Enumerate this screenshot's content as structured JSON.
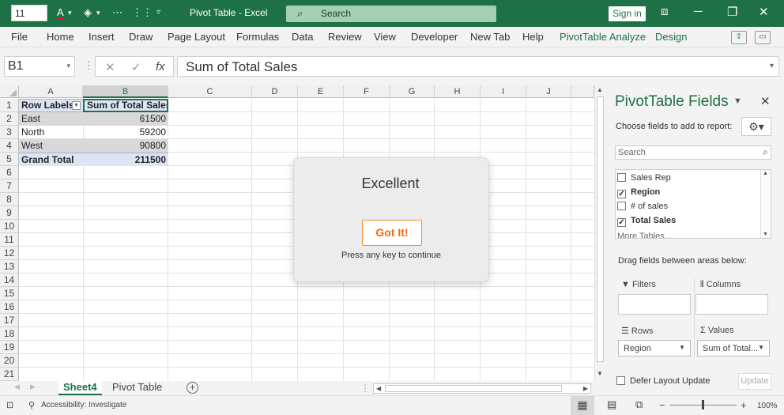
{
  "titlebar": {
    "font_size_value": "11",
    "doc_title": "Pivot Table  -  Excel",
    "search_placeholder": "Search",
    "signin": "Sign in",
    "accent": "#1e7145"
  },
  "menu": [
    "File",
    "Home",
    "Insert",
    "Draw",
    "Page Layout",
    "Formulas",
    "Data",
    "Review",
    "View",
    "Developer",
    "New Tab",
    "Help",
    "PivotTable Analyze",
    "Design"
  ],
  "formula_bar": {
    "name_box": "B1",
    "cancel_glyph": "✕",
    "enter_glyph": "✓",
    "fx": "fx",
    "content": "Sum of Total Sales"
  },
  "sheet": {
    "columns": [
      "A",
      "B",
      "C",
      "D",
      "E",
      "F",
      "G",
      "H",
      "I",
      "J"
    ],
    "rows": [
      "1",
      "2",
      "3",
      "4",
      "5",
      "6",
      "7",
      "8",
      "9",
      "10",
      "11",
      "12",
      "13",
      "14",
      "15",
      "16",
      "17",
      "18",
      "19",
      "20",
      "21"
    ],
    "pivot": {
      "header": [
        "Row Labels",
        "Sum of Total Sales"
      ],
      "rows": [
        [
          "East",
          "61500"
        ],
        [
          "North",
          "59200"
        ],
        [
          "West",
          "90800"
        ]
      ],
      "total": [
        "Grand Total",
        "211500"
      ]
    }
  },
  "tabs": {
    "active": "Sheet4",
    "other": "Pivot Table",
    "add": "+"
  },
  "status": {
    "accessibility": "Accessibility: Investigate",
    "zoom": "100%",
    "zoom_minus": "−",
    "zoom_plus": "+"
  },
  "pivot_panel": {
    "title": "PivotTable Fields",
    "subtitle": "Choose fields to add to report:",
    "search_placeholder": "Search",
    "fields": [
      {
        "name": "Sales Rep",
        "checked": false
      },
      {
        "name": "Region",
        "checked": true
      },
      {
        "name": "# of sales",
        "checked": false
      },
      {
        "name": "Total Sales",
        "checked": true
      }
    ],
    "more_tables": "More Tables...",
    "drag_hint": "Drag fields between areas below:",
    "areas": {
      "filters": "Filters",
      "columns": "Columns",
      "rows": "Rows",
      "values": "Values"
    },
    "rows_value": "Region",
    "values_value": "Sum of Total...",
    "defer": "Defer Layout Update",
    "update": "Update"
  },
  "dialog": {
    "heading": "Excellent",
    "button": "Got It!",
    "hint": "Press any key to continue",
    "button_color": "#f06a11"
  }
}
